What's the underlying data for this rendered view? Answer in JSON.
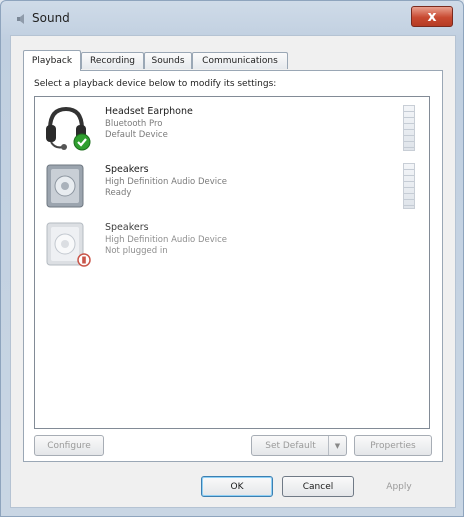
{
  "window": {
    "title": "Sound",
    "close_glyph": "x"
  },
  "tabs": [
    {
      "label": "Playback",
      "active": true
    },
    {
      "label": "Recording",
      "active": false
    },
    {
      "label": "Sounds",
      "active": false
    },
    {
      "label": "Communications",
      "active": false
    }
  ],
  "playback": {
    "instruction": "Select a playback device below to modify its settings:",
    "devices": [
      {
        "name": "Headset Earphone",
        "line1": "Bluetooth Pro",
        "line2": "Default Device",
        "icon": "headset-icon",
        "status_icon": "checkmark-icon"
      },
      {
        "name": "Speakers",
        "line1": "High Definition Audio Device",
        "line2": "Ready",
        "icon": "speaker-icon",
        "status_icon": ""
      },
      {
        "name": "Speakers",
        "line1": "High Definition Audio Device",
        "line2": "Not plugged in",
        "icon": "speaker-icon",
        "status_icon": "unplugged-icon"
      }
    ]
  },
  "panel_buttons": {
    "configure": "Configure",
    "set_default": "Set Default",
    "set_default_arrow": "▼",
    "properties": "Properties"
  },
  "dialog_buttons": {
    "ok": "OK",
    "cancel": "Cancel",
    "apply": "Apply"
  },
  "colors": {
    "accent": "#3c7fb1",
    "check": "#2f9e2f",
    "unplugged": "#c0392b"
  }
}
